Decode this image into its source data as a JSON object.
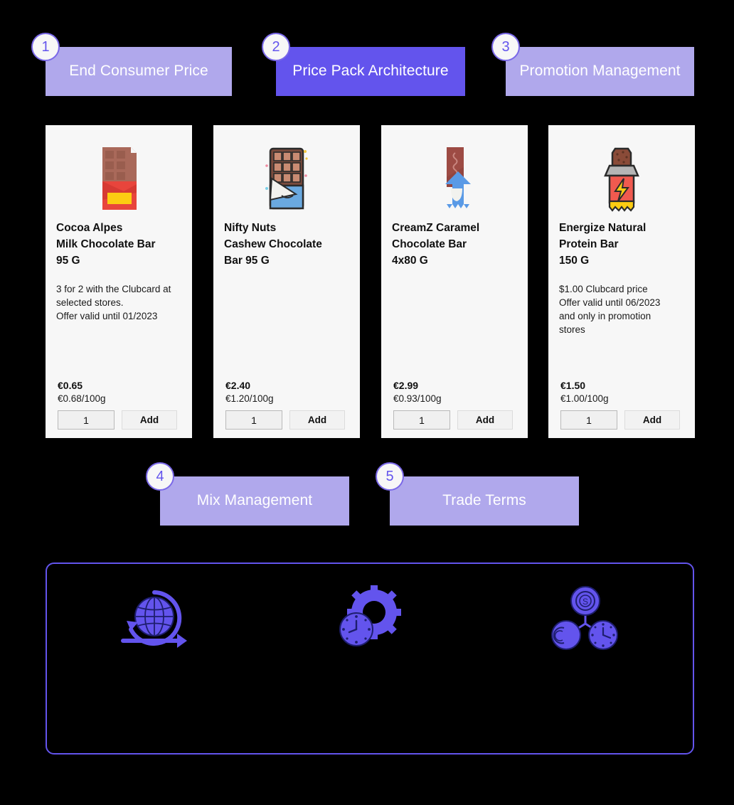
{
  "steps": [
    {
      "number": "1",
      "label": "End Consumer\nPrice",
      "state": "inactive"
    },
    {
      "number": "2",
      "label": "Price Pack\nArchitecture",
      "state": "active"
    },
    {
      "number": "3",
      "label": "Promotion\nManagement",
      "state": "inactive"
    },
    {
      "number": "4",
      "label": "Mix Management",
      "state": "inactive"
    },
    {
      "number": "5",
      "label": "Trade Terms",
      "state": "inactive"
    }
  ],
  "products": [
    {
      "image": "chocolate-bar-red-wrapper-icon",
      "title": "Cocoa Alpes\nMilk Chocolate Bar\n95 G",
      "promo": "3 for 2 with the Clubcard at\nselected stores.\nOffer valid until 01/2023",
      "price": "€0.65",
      "unit_price": "€0.68/100g",
      "quantity": "1",
      "add_label": "Add"
    },
    {
      "image": "chocolate-bar-blue-wrapper-icon",
      "title": "Nifty Nuts\nCashew Chocolate\nBar 95 G",
      "promo": "",
      "price": "€2.40",
      "unit_price": "€1.20/100g",
      "quantity": "1",
      "add_label": "Add"
    },
    {
      "image": "caramel-bar-blue-wrapper-icon",
      "title": "CreamZ Caramel\nChocolate Bar\n4x80 G",
      "promo": "",
      "price": "€2.99",
      "unit_price": "€0.93/100g",
      "quantity": "1",
      "add_label": "Add"
    },
    {
      "image": "protein-bar-lightning-icon",
      "title": "Energize Natural\nProtein Bar\n150 G",
      "promo": "$1.00 Clubcard price\nOffer valid until 06/2023\nand only in promotion\nstores",
      "price": "€1.50",
      "unit_price": "€1.00/100g",
      "quantity": "1",
      "add_label": "Add"
    }
  ],
  "panel": {
    "icons": [
      "globe-cycle-icon",
      "gear-clock-icon",
      "money-network-icon"
    ]
  },
  "colors": {
    "accent": "#6354ed",
    "chip_light": "#b0a8ec",
    "chip_dark": "#6354ed",
    "card_bg": "#f7f7f7",
    "background": "#000000"
  }
}
